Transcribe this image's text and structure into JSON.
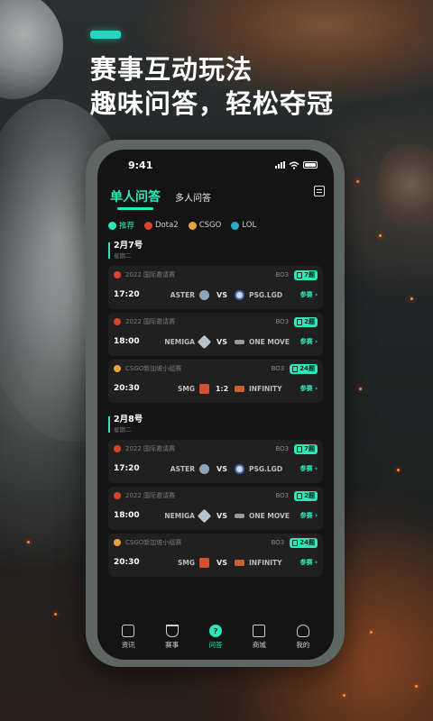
{
  "promo": {
    "headline_line1": "赛事互动玩法",
    "headline_line2": "趣味问答，轻松夺冠",
    "accent_color": "#1fd9c0"
  },
  "status_bar": {
    "time": "9:41"
  },
  "header": {
    "tabs": [
      {
        "label": "单人问答",
        "active": true
      },
      {
        "label": "多人问答",
        "active": false
      }
    ],
    "right_icon": "edit-note-icon"
  },
  "filters": [
    {
      "label": "推荐",
      "icon": "flame-icon",
      "active": true
    },
    {
      "label": "Dota2",
      "icon": "dota2-icon",
      "active": false
    },
    {
      "label": "CSGO",
      "icon": "csgo-icon",
      "active": false
    },
    {
      "label": "LOL",
      "icon": "lol-icon",
      "active": false
    }
  ],
  "days": [
    {
      "date": "2月7号",
      "weekday": "星期二",
      "matches": [
        {
          "tournament": "2022 国际邀请赛",
          "game": "dota2",
          "format": "BO3",
          "questions": "7题",
          "time": "17:20",
          "team_a": "ASTER",
          "score": "VS",
          "team_b": "PSG.LGD",
          "action": "参赛"
        },
        {
          "tournament": "2022 国际邀请赛",
          "game": "dota2",
          "format": "BO3",
          "questions": "2题",
          "time": "18:00",
          "team_a": "NEMIGA",
          "score": "VS",
          "team_b": "ONE MOVE",
          "action": "参赛"
        },
        {
          "tournament": "CSGO新加坡小组赛",
          "game": "csgo",
          "format": "BO3",
          "questions": "24题",
          "time": "20:30",
          "team_a": "SMG",
          "score": "1:2",
          "team_b": "INFINITY",
          "action": "参赛"
        }
      ]
    },
    {
      "date": "2月8号",
      "weekday": "星期二",
      "matches": [
        {
          "tournament": "2022 国际邀请赛",
          "game": "dota2",
          "format": "BO3",
          "questions": "7题",
          "time": "17:20",
          "team_a": "ASTER",
          "score": "VS",
          "team_b": "PSG.LGD",
          "action": "参赛"
        },
        {
          "tournament": "2022 国际邀请赛",
          "game": "dota2",
          "format": "BO3",
          "questions": "2题",
          "time": "18:00",
          "team_a": "NEMIGA",
          "score": "VS",
          "team_b": "ONE MOVE",
          "action": "参赛"
        },
        {
          "tournament": "CSGO新加坡小组赛",
          "game": "csgo",
          "format": "BO3",
          "questions": "24题",
          "time": "20:30",
          "team_a": "SMG",
          "score": "VS",
          "team_b": "INFINITY",
          "action": "参赛"
        }
      ]
    }
  ],
  "bottom_nav": [
    {
      "label": "资讯",
      "icon": "news-icon",
      "active": false
    },
    {
      "label": "赛事",
      "icon": "trophy-icon",
      "active": false
    },
    {
      "label": "问答",
      "icon": "question-icon",
      "active": true
    },
    {
      "label": "商城",
      "icon": "shopping-bag-icon",
      "active": false
    },
    {
      "label": "我的",
      "icon": "user-icon",
      "active": false
    }
  ],
  "colors": {
    "accent": "#2fe6b8",
    "screen_bg": "#141414",
    "card_bg": "#202020",
    "dota": "#d8432a",
    "csgo": "#e9a23b",
    "lol": "#2aa9c8"
  }
}
